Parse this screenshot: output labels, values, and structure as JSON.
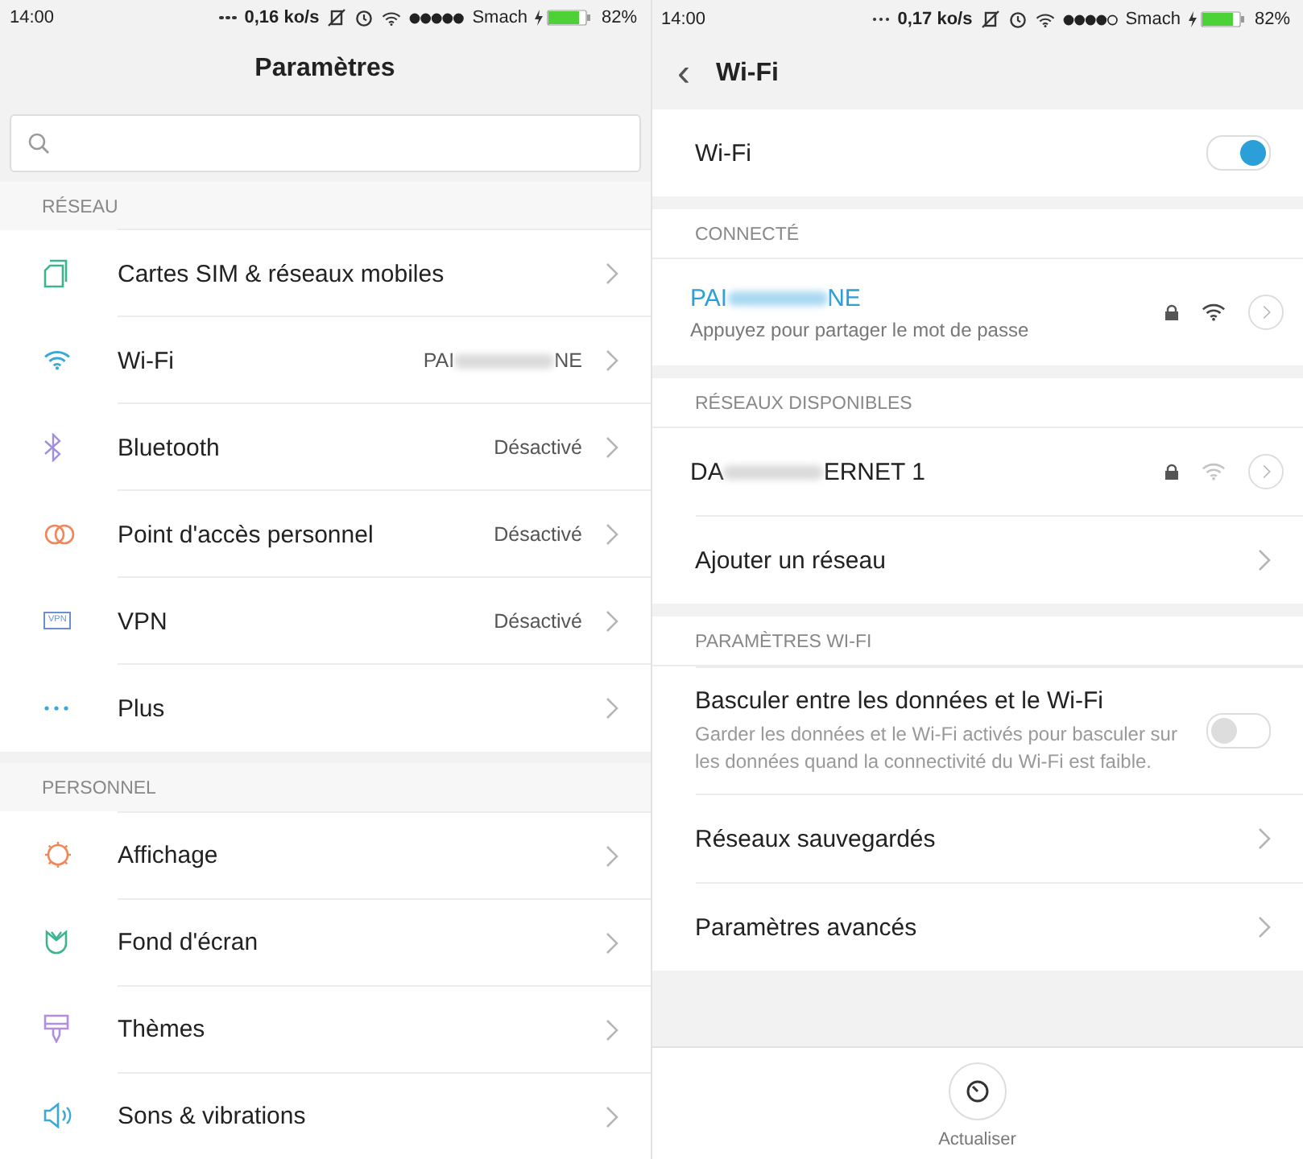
{
  "status_bars": [
    {
      "time": "14:00",
      "speed": "0,16 ko/s",
      "carrier": "Smach",
      "battery": "82%"
    },
    {
      "time": "14:00",
      "speed": "0,17 ko/s",
      "carrier": "Smach",
      "battery": "82%"
    }
  ],
  "settings": {
    "title": "Paramètres",
    "sections": [
      {
        "header": "RÉSEAU",
        "items": [
          {
            "kind": "sim",
            "label": "Cartes SIM & réseaux mobiles"
          },
          {
            "kind": "wifi",
            "label": "Wi-Fi",
            "value_start": "PAI",
            "value_end": "NE"
          },
          {
            "kind": "bluetooth",
            "label": "Bluetooth",
            "value": "Désactivé"
          },
          {
            "kind": "hotspot",
            "label": "Point d'accès personnel",
            "value": "Désactivé"
          },
          {
            "kind": "vpn",
            "label": "VPN",
            "value": "Désactivé",
            "icon_text": "VPN"
          },
          {
            "kind": "more",
            "label": "Plus"
          }
        ]
      },
      {
        "header": "PERSONNEL",
        "items": [
          {
            "kind": "display",
            "label": "Affichage"
          },
          {
            "kind": "wallpaper",
            "label": "Fond d'écran"
          },
          {
            "kind": "themes",
            "label": "Thèmes"
          },
          {
            "kind": "sound",
            "label": "Sons & vibrations"
          }
        ]
      }
    ]
  },
  "wifi": {
    "back": "‹",
    "title": "Wi-Fi",
    "toggle": {
      "label": "Wi-Fi",
      "on": true
    },
    "connected": {
      "header": "CONNECTÉ",
      "networks": [
        {
          "name_start": "PAI",
          "name_end": "NE",
          "subtitle": "Appuyez pour partager le mot de passe",
          "locked": true,
          "connected": true
        }
      ]
    },
    "available": {
      "header": "RÉSEAUX DISPONIBLES",
      "networks": [
        {
          "name_start": "DA",
          "name_end": "ERNET 1",
          "locked": true,
          "connected": false
        }
      ],
      "add": "Ajouter un réseau"
    },
    "options": {
      "header": "PARAMÈTRES WI-FI",
      "items": [
        {
          "kind": "toggle",
          "label": "Basculer entre les données et le Wi-Fi",
          "description": "Garder les données et le Wi-Fi activés pour basculer sur les données quand la connectivité du Wi-Fi est faible.",
          "on": false
        },
        {
          "kind": "link",
          "label": "Réseaux sauvegardés"
        },
        {
          "kind": "link",
          "label": "Paramètres avancés"
        }
      ]
    },
    "refresh": {
      "label": "Actualiser"
    }
  }
}
